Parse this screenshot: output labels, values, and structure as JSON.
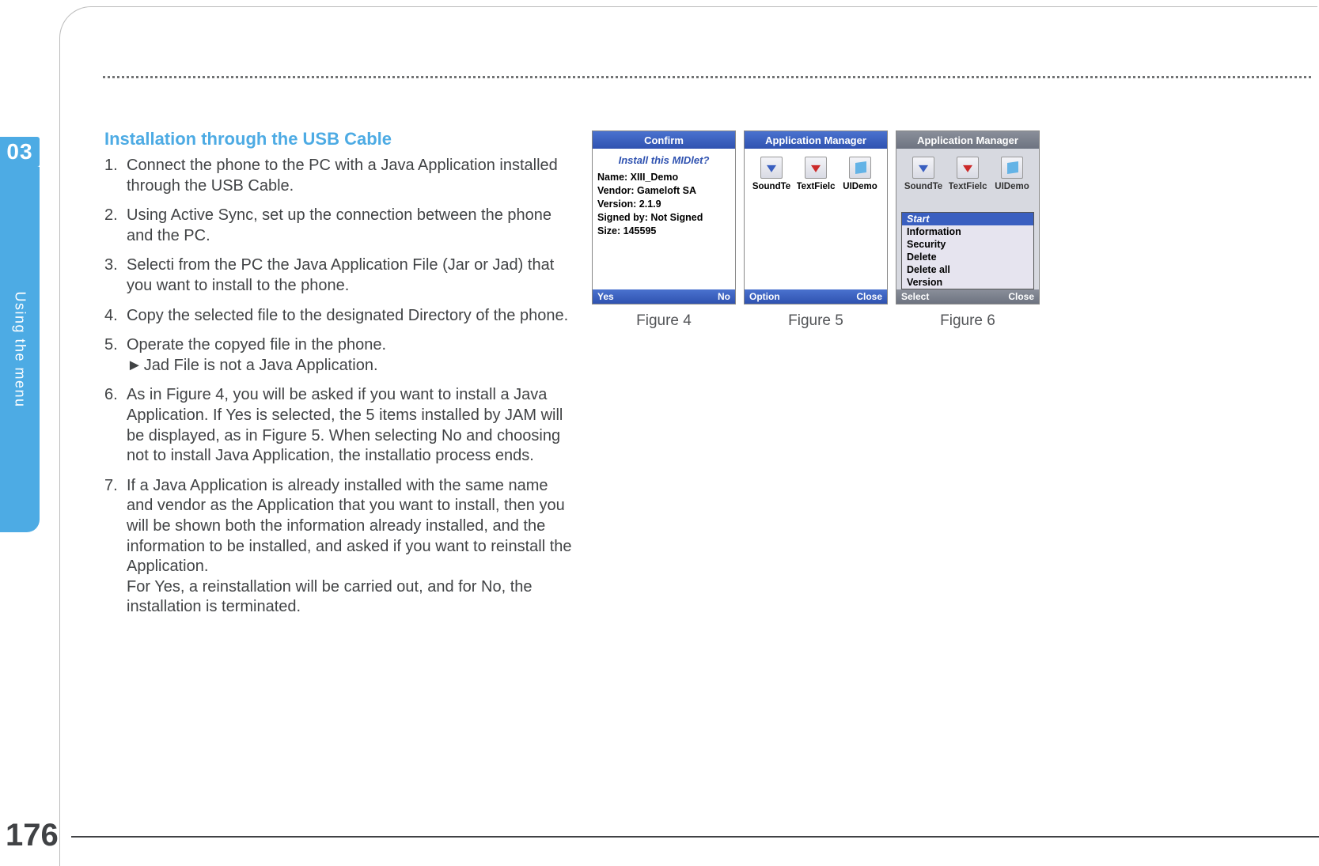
{
  "chapter_number": "03",
  "side_tab_label": "Using the menu",
  "page_number": "176",
  "section_title": "Installation through the USB Cable",
  "steps": [
    {
      "num": "1.",
      "text": "Connect the phone to the PC with a Java Application installed through the USB Cable."
    },
    {
      "num": "2.",
      "text": "Using Active Sync, set up the connection between the phone and the PC."
    },
    {
      "num": "3.",
      "text": "Selecti from the PC the Java Application File (Jar or Jad) that you want to install to the phone."
    },
    {
      "num": "4.",
      "text": "Copy the selected file to the designated Directory of the phone."
    },
    {
      "num": "5.",
      "text": "Operate the copyed file in the phone.",
      "note": "Jad File is not a Java Application."
    },
    {
      "num": "6.",
      "text": "As in Figure 4, you will be asked if you want to install a Java Application. If Yes is selected, the 5 items installed by JAM will be displayed, as in Figure 5. When selecting No and choosing not to install Java Application, the installatio process ends."
    },
    {
      "num": "7.",
      "text": "If a Java Application is already installed with the same name and vendor as the Application that you want to install, then you will be shown both the information already installed, and the information to be installed, and asked if you want to reinstall the Application.\nFor Yes, a reinstallation will be carried out, and for No, the installation is terminated."
    }
  ],
  "figure4": {
    "caption": "Figure 4",
    "title": "Confirm",
    "subtitle": "Install this MIDlet?",
    "lines": [
      "Name: XIII_Demo",
      "Vendor: Gameloft SA",
      "Version: 2.1.9",
      "Signed by: Not Signed",
      "Size: 145595"
    ],
    "soft_left": "Yes",
    "soft_right": "No"
  },
  "figure5": {
    "caption": "Figure 5",
    "title": "Application  Manager",
    "apps": [
      {
        "label": "SoundTe"
      },
      {
        "label": "TextFielc"
      },
      {
        "label": "UIDemo"
      }
    ],
    "soft_left": "Option",
    "soft_right": "Close"
  },
  "figure6": {
    "caption": "Figure 6",
    "title": "Application  Manager",
    "apps": [
      {
        "label": "SoundTe"
      },
      {
        "label": "TextFielc"
      },
      {
        "label": "UIDemo"
      }
    ],
    "menu": [
      {
        "label": "Start",
        "active": true
      },
      {
        "label": "Information",
        "active": false
      },
      {
        "label": "Security",
        "active": false
      },
      {
        "label": "Delete",
        "active": false
      },
      {
        "label": "Delete  all",
        "active": false
      },
      {
        "label": "Version",
        "active": false
      }
    ],
    "soft_left": "Select",
    "soft_right": "Close"
  }
}
